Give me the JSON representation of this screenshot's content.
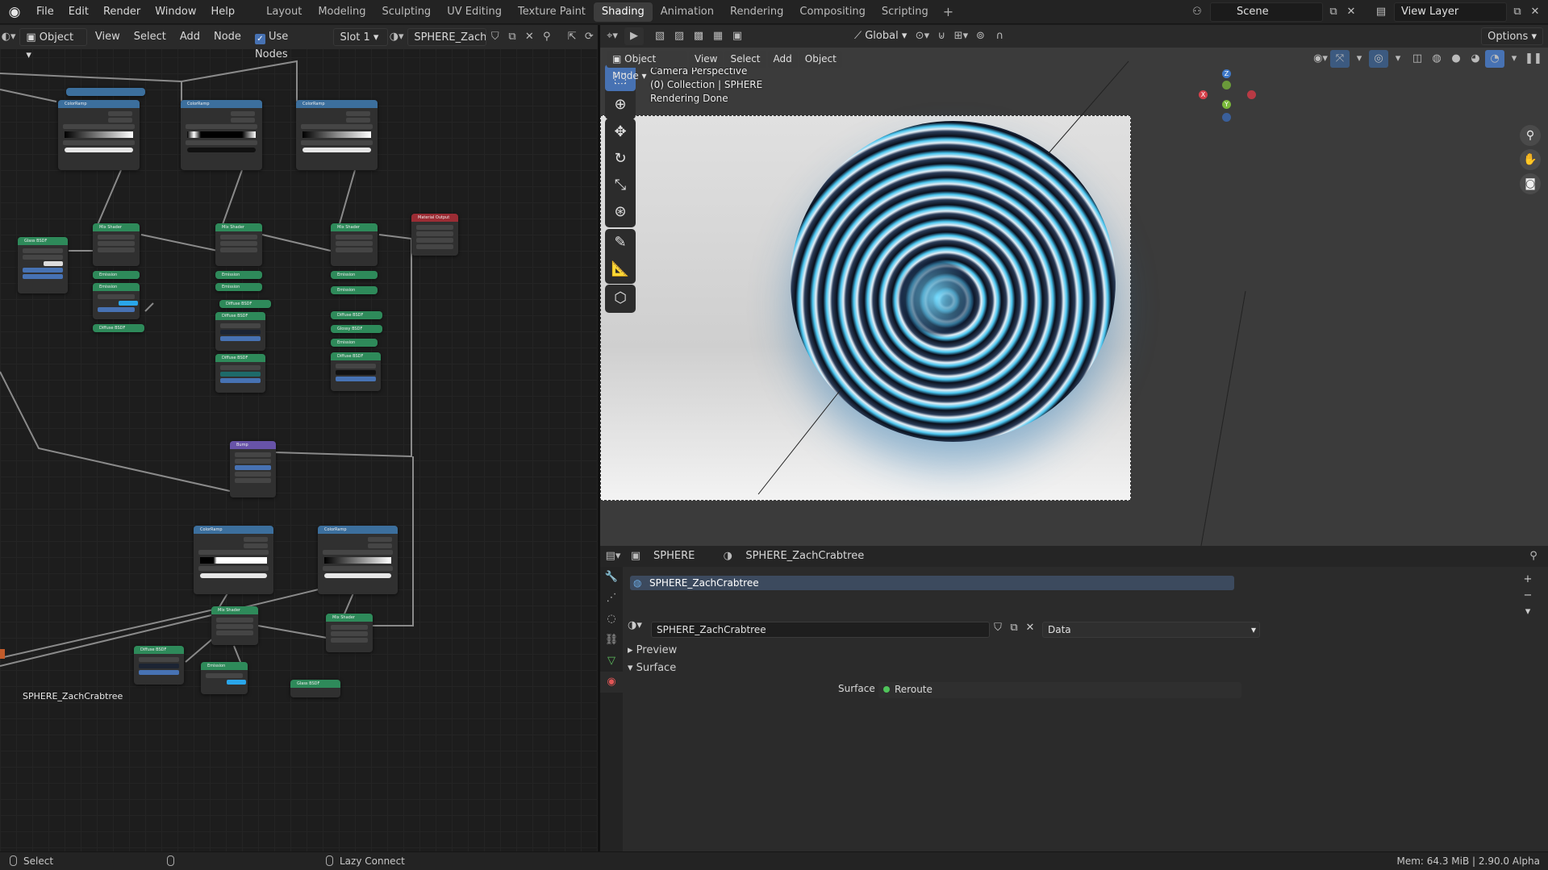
{
  "menu": {
    "items": [
      "File",
      "Edit",
      "Render",
      "Window",
      "Help"
    ],
    "workspaces": [
      "Layout",
      "Modeling",
      "Sculpting",
      "UV Editing",
      "Texture Paint",
      "Shading",
      "Animation",
      "Rendering",
      "Compositing",
      "Scripting"
    ],
    "active_workspace": "Shading",
    "add_tab": "+",
    "scene": "Scene",
    "view_layer": "View Layer"
  },
  "node_editor": {
    "object_mode": "Object",
    "menus": [
      "View",
      "Select",
      "Add",
      "Node"
    ],
    "use_nodes_label": "Use Nodes",
    "slot": "Slot 1",
    "material": "SPHERE_ZachCrabtr...",
    "tree_label": "SPHERE_ZachCrabtree",
    "nodes": {
      "colorramp": "ColorRamp",
      "mix_shader": "Mix Shader",
      "emission": "Emission",
      "diffuse": "Diffuse BSDF",
      "glossy": "Glossy BSDF",
      "glass": "Glass BSDF",
      "material_output": "Material Output",
      "bump": "Bump"
    }
  },
  "viewport": {
    "transform": "Global",
    "options": "Options",
    "mode": "Object Mode",
    "menus": [
      "View",
      "Select",
      "Add",
      "Object"
    ],
    "overlay_lines": [
      "Camera Perspective",
      "(0) Collection | SPHERE",
      "Rendering Done"
    ],
    "axes": {
      "x": "X",
      "y": "Y",
      "z": "Z"
    }
  },
  "properties": {
    "object": "SPHERE",
    "material_breadcrumb": "SPHERE_ZachCrabtree",
    "slot_material": "SPHERE_ZachCrabtree",
    "material_field": "SPHERE_ZachCrabtree",
    "link": "Data",
    "panels": [
      "Preview",
      "Surface"
    ],
    "surface_label": "Surface",
    "surface_value": "Reroute"
  },
  "status": {
    "left": "Select",
    "middle": "Lazy Connect",
    "right": "Mem: 64.3 MiB | 2.90.0 Alpha"
  }
}
